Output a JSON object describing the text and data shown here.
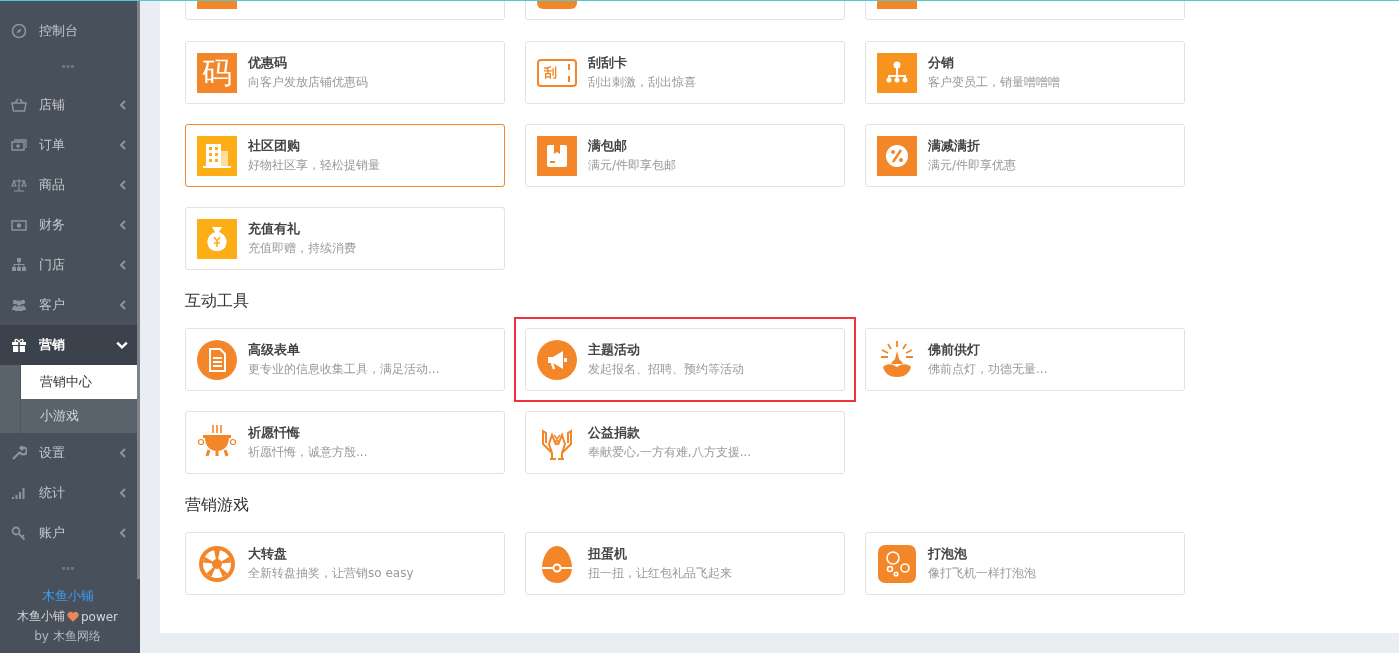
{
  "sidebar": {
    "items": [
      {
        "label": "控制台",
        "selected": false,
        "expanded": false,
        "has_arrow": false
      },
      {
        "label": "店铺",
        "selected": false,
        "expanded": false,
        "has_arrow": true
      },
      {
        "label": "订单",
        "selected": false,
        "expanded": false,
        "has_arrow": true
      },
      {
        "label": "商品",
        "selected": false,
        "expanded": false,
        "has_arrow": true
      },
      {
        "label": "财务",
        "selected": false,
        "expanded": false,
        "has_arrow": true
      },
      {
        "label": "门店",
        "selected": false,
        "expanded": false,
        "has_arrow": true
      },
      {
        "label": "客户",
        "selected": false,
        "expanded": false,
        "has_arrow": true
      },
      {
        "label": "营销",
        "selected": true,
        "expanded": true,
        "has_arrow": true,
        "children": [
          {
            "label": "营销中心",
            "selected": true
          },
          {
            "label": "小游戏",
            "selected": false
          }
        ]
      },
      {
        "label": "设置",
        "selected": false,
        "expanded": false,
        "has_arrow": true
      },
      {
        "label": "统计",
        "selected": false,
        "expanded": false,
        "has_arrow": true
      },
      {
        "label": "账户",
        "selected": false,
        "expanded": false,
        "has_arrow": true
      }
    ],
    "footer": {
      "brand": "木鱼小铺",
      "power_prefix": "木鱼小铺",
      "power_suffix": "power",
      "by": "by 木鱼网络"
    }
  },
  "sections": [
    {
      "cards": [
        {
          "title": "优惠码",
          "desc": "向客户发放店铺优惠码",
          "icon_text": "码",
          "selected": false,
          "highlighted": false
        },
        {
          "title": "刮刮卡",
          "desc": "刮出刺激，刮出惊喜",
          "icon_text": "刮",
          "selected": false,
          "highlighted": false
        },
        {
          "title": "分销",
          "desc": "客户变员工，销量噌噌噌",
          "selected": false,
          "highlighted": false
        },
        {
          "title": "社区团购",
          "desc": "好物社区享，轻松提销量",
          "selected": true,
          "highlighted": false
        },
        {
          "title": "满包邮",
          "desc": "满元/件即享包邮",
          "selected": false,
          "highlighted": false
        },
        {
          "title": "满减满折",
          "desc": "满元/件即享优惠",
          "selected": false,
          "highlighted": false
        },
        {
          "title": "充值有礼",
          "desc": "充值即赠，持续消费",
          "selected": false,
          "highlighted": false
        }
      ]
    },
    {
      "heading": "互动工具",
      "cards": [
        {
          "title": "高级表单",
          "desc": "更专业的信息收集工具，满足活动...",
          "selected": false,
          "highlighted": false
        },
        {
          "title": "主题活动",
          "desc": "发起报名、招聘、预约等活动",
          "selected": false,
          "highlighted": true
        },
        {
          "title": "佛前供灯",
          "desc": "佛前点灯，功德无量...",
          "selected": false,
          "highlighted": false
        },
        {
          "title": "祈愿忏悔",
          "desc": "祈愿忏悔，诚意方殷...",
          "selected": false,
          "highlighted": false
        },
        {
          "title": "公益捐款",
          "desc": "奉献爱心,一方有难,八方支援...",
          "selected": false,
          "highlighted": false
        }
      ]
    },
    {
      "heading": "营销游戏",
      "cards": [
        {
          "title": "大转盘",
          "desc": "全新转盘抽奖，让营销so easy",
          "selected": false,
          "highlighted": false
        },
        {
          "title": "扭蛋机",
          "desc": "扭一扭，让红包礼品飞起来",
          "selected": false,
          "highlighted": false
        },
        {
          "title": "打泡泡",
          "desc": "像打飞机一样打泡泡",
          "selected": false,
          "highlighted": false
        }
      ]
    }
  ]
}
